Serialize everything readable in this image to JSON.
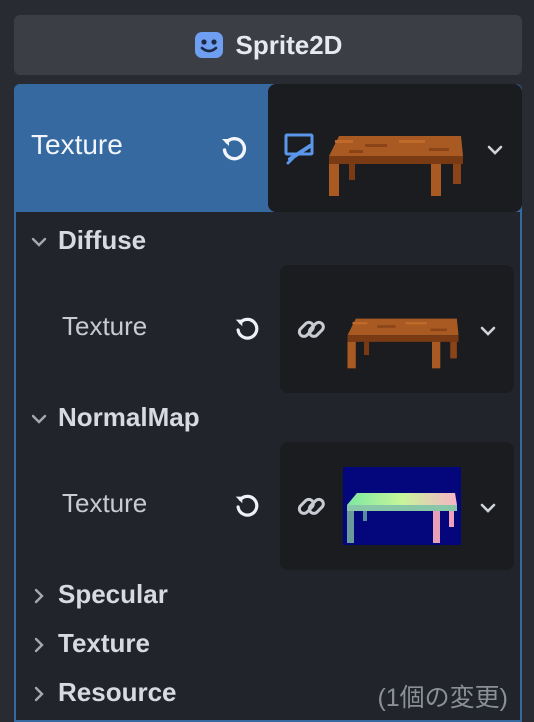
{
  "header": {
    "title": "Sprite2D",
    "icon": "sprite2d-node-icon"
  },
  "texture_property": {
    "label": "Texture",
    "resource_icon": "canvas-texture-icon",
    "preview": "wooden-table-sprite"
  },
  "sections": {
    "diffuse": {
      "label": "Diffuse",
      "expanded": true,
      "texture_label": "Texture",
      "preview": "wooden-table-sprite"
    },
    "normal_map": {
      "label": "NormalMap",
      "expanded": true,
      "texture_label": "Texture",
      "preview": "table-normal-map"
    },
    "specular": {
      "label": "Specular",
      "expanded": false
    },
    "texture": {
      "label": "Texture",
      "expanded": false
    },
    "resource": {
      "label": "Resource",
      "expanded": false,
      "note": "(1個の変更)"
    }
  },
  "colors": {
    "selected": "#3569a0",
    "panel": "#21252b",
    "slot": "#1b1c1f",
    "accent_icon": "#5a96ea"
  }
}
